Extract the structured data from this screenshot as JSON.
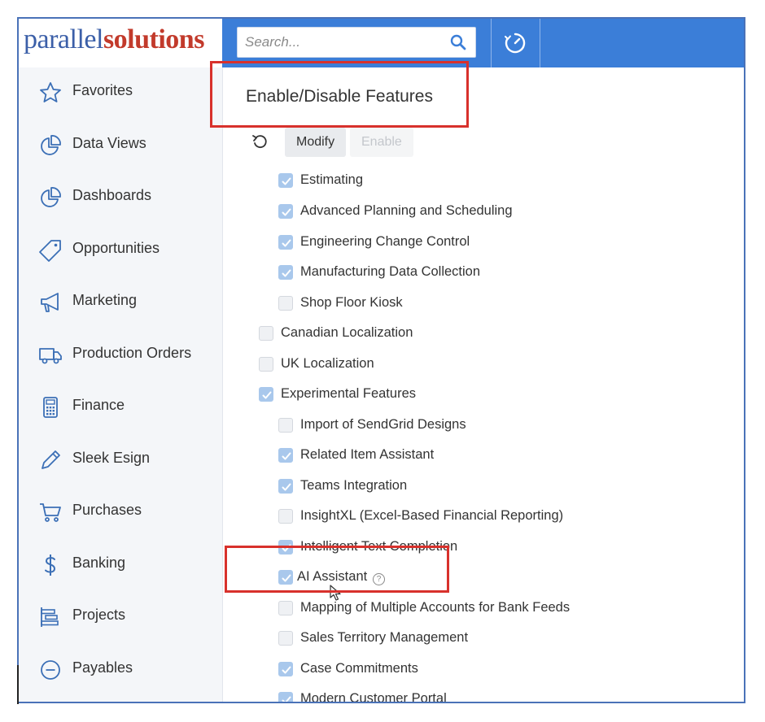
{
  "brand": {
    "part1": "parallel",
    "part2": "solutions"
  },
  "search": {
    "placeholder": "Search..."
  },
  "sidebar": {
    "items": [
      {
        "label": "Favorites",
        "icon": "star-icon"
      },
      {
        "label": "Data Views",
        "icon": "pie-chart-icon"
      },
      {
        "label": "Dashboards",
        "icon": "pie-chart-icon"
      },
      {
        "label": "Opportunities",
        "icon": "tag-icon"
      },
      {
        "label": "Marketing",
        "icon": "megaphone-icon"
      },
      {
        "label": "Production Orders",
        "icon": "truck-icon"
      },
      {
        "label": "Finance",
        "icon": "calculator-icon"
      },
      {
        "label": "Sleek Esign",
        "icon": "pen-icon"
      },
      {
        "label": "Purchases",
        "icon": "cart-icon"
      },
      {
        "label": "Banking",
        "icon": "dollar-icon"
      },
      {
        "label": "Projects",
        "icon": "projects-icon"
      },
      {
        "label": "Payables",
        "icon": "minus-circle-icon"
      }
    ]
  },
  "main": {
    "title": "Enable/Disable Features",
    "toolbar": {
      "modify": "Modify",
      "enable": "Enable"
    },
    "features": [
      {
        "label": "Estimating",
        "checked": true
      },
      {
        "label": "Advanced Planning and Scheduling",
        "checked": true
      },
      {
        "label": "Engineering Change Control",
        "checked": true
      },
      {
        "label": "Manufacturing Data Collection",
        "checked": true
      },
      {
        "label": "Shop Floor Kiosk",
        "checked": false
      },
      {
        "label": "Canadian Localization",
        "checked": false
      },
      {
        "label": "UK Localization",
        "checked": false
      },
      {
        "label": "Experimental Features",
        "checked": true
      },
      {
        "label": "Import of SendGrid Designs",
        "checked": false
      },
      {
        "label": "Related Item Assistant",
        "checked": true
      },
      {
        "label": "Teams Integration",
        "checked": true
      },
      {
        "label": "InsightXL (Excel-Based Financial Reporting)",
        "checked": false
      },
      {
        "label": "Intelligent Text Completion",
        "checked": true
      },
      {
        "label": "AI Assistant",
        "checked": true
      },
      {
        "label": "Mapping of Multiple Accounts for Bank Feeds",
        "checked": false
      },
      {
        "label": "Sales Territory Management",
        "checked": false
      },
      {
        "label": "Case Commitments",
        "checked": true
      },
      {
        "label": "Modern Customer Portal",
        "checked": true
      }
    ]
  },
  "colors": {
    "topbar": "#3b7ed8",
    "highlight": "#d8312c",
    "checkbox_checked": "#a9c8ec"
  }
}
